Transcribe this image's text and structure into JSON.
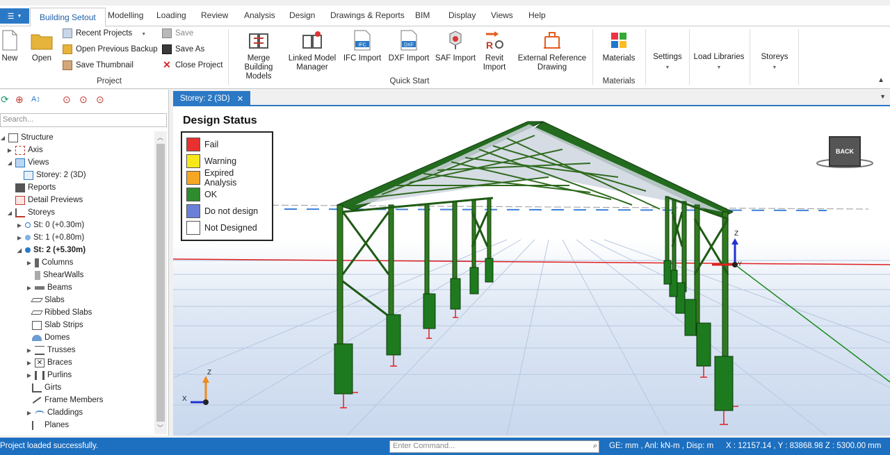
{
  "ribbon_tabs": [
    "Building Setout",
    "Modelling",
    "Loading",
    "Review",
    "Analysis",
    "Design",
    "Drawings & Reports",
    "BIM",
    "Display",
    "Views",
    "Help"
  ],
  "file_menu_icon": "app-menu-icon",
  "project_group": {
    "title": "Project",
    "new": "New",
    "open": "Open",
    "recent": "Recent Projects",
    "open_backup": "Open Previous Backup",
    "save_thumbnail": "Save Thumbnail",
    "save": "Save",
    "save_as": "Save As",
    "close": "Close Project"
  },
  "quickstart_group": {
    "title": "Quick Start",
    "merge": "Merge Building Models",
    "linked": "Linked Model Manager",
    "ifc": "IFC Import",
    "dxf": "DXF Import",
    "saf": "SAF Import",
    "revit": "Revit Import",
    "external": "External Reference Drawing"
  },
  "materials_group": {
    "title": "Materials",
    "materials": "Materials"
  },
  "settings": "Settings",
  "load_libraries": "Load Libraries",
  "storeys_btn": "Storeys",
  "search_placeholder": "Search...",
  "tree": {
    "structure": "Structure",
    "axis": "Axis",
    "views": "Views",
    "storey_view": "Storey: 2 (3D)",
    "reports": "Reports",
    "detail_previews": "Detail Previews",
    "storeys": "Storeys",
    "st0": "St: 0 (+0.30m)",
    "st1": "St: 1 (+0.80m)",
    "st2": "St: 2 (+5.30m)",
    "columns": "Columns",
    "shearwalls": "ShearWalls",
    "beams": "Beams",
    "slabs": "Slabs",
    "ribbed_slabs": "Ribbed Slabs",
    "slab_strips": "Slab Strips",
    "domes": "Domes",
    "trusses": "Trusses",
    "braces": "Braces",
    "purlins": "Purlins",
    "girts": "Girts",
    "frame_members": "Frame Members",
    "claddings": "Claddings",
    "planes": "Planes"
  },
  "view_tab": "Storey: 2 (3D)",
  "legend": {
    "title": "Design Status",
    "items": [
      {
        "label": "Fail",
        "color": "#e8312f"
      },
      {
        "label": "Warning",
        "color": "#f7e81c"
      },
      {
        "label": "Expired Analysis",
        "color": "#f5a623"
      },
      {
        "label": "OK",
        "color": "#2e8b2e"
      },
      {
        "label": "Do not design",
        "color": "#6a7fd8"
      },
      {
        "label": "Not Designed",
        "color": "#ffffff"
      }
    ]
  },
  "view_cube": "BACK",
  "axes": {
    "x": "X",
    "y": "Y",
    "z": "Z"
  },
  "status": {
    "message": "Project loaded successfully.",
    "command_placeholder": "Enter Command...",
    "units": "GE: mm , Anl: kN-m , Disp: m",
    "coords": "X : 12157.14 , Y : 83868.98    Z : 5300.00 mm"
  },
  "colors": {
    "accent": "#2b78c5",
    "structure": "#2f6b1f"
  }
}
